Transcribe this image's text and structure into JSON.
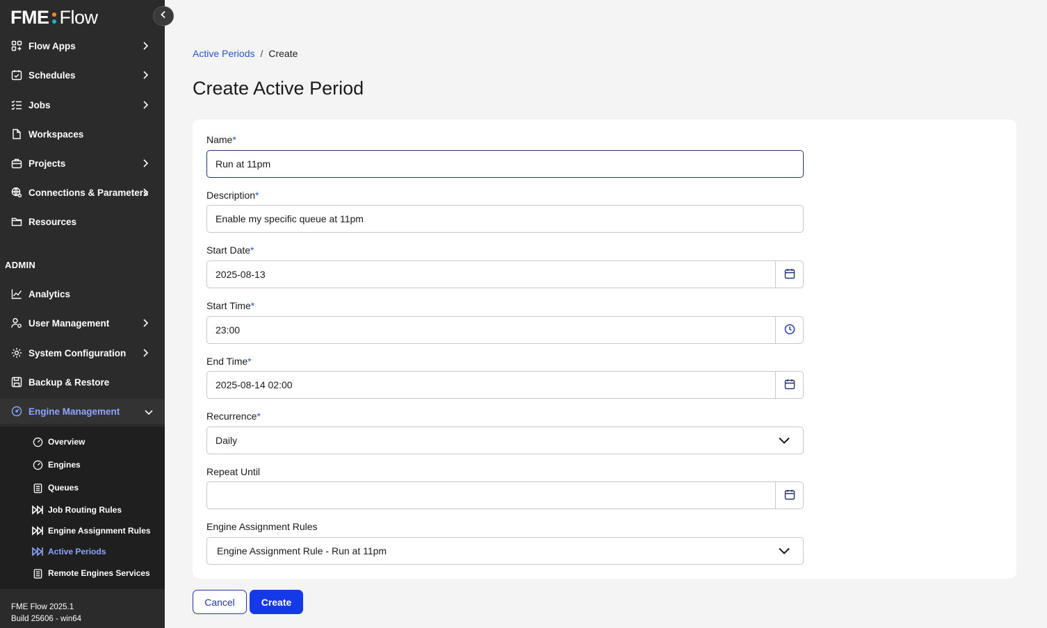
{
  "app": {
    "logo_left": "FME",
    "logo_right": "Flow"
  },
  "sidebar": {
    "items": [
      {
        "label": "Flow Apps",
        "icon": "grid-icon",
        "has_children": true
      },
      {
        "label": "Schedules",
        "icon": "calendar-check-icon",
        "has_children": true
      },
      {
        "label": "Jobs",
        "icon": "list-check-icon",
        "has_children": true
      },
      {
        "label": "Workspaces",
        "icon": "file-icon",
        "has_children": false
      },
      {
        "label": "Projects",
        "icon": "briefcase-icon",
        "has_children": true
      },
      {
        "label": "Connections & Parameters",
        "icon": "globe-gear-icon",
        "has_children": true
      },
      {
        "label": "Resources",
        "icon": "folder-icon",
        "has_children": false
      }
    ],
    "admin_label": "ADMIN",
    "admin_items": [
      {
        "label": "Analytics",
        "icon": "chart-line-icon",
        "has_children": false
      },
      {
        "label": "User Management",
        "icon": "user-gear-icon",
        "has_children": true
      },
      {
        "label": "System Configuration",
        "icon": "gear-icon",
        "has_children": true
      },
      {
        "label": "Backup & Restore",
        "icon": "save-icon",
        "has_children": false
      },
      {
        "label": "Engine Management",
        "icon": "gauge-icon",
        "has_children": true,
        "expanded": true,
        "active": true
      }
    ],
    "engine_subitems": [
      {
        "label": "Overview",
        "icon": "gauge-icon"
      },
      {
        "label": "Engines",
        "icon": "gauge-icon"
      },
      {
        "label": "Queues",
        "icon": "clipboard-icon"
      },
      {
        "label": "Job Routing Rules",
        "icon": "route-icon"
      },
      {
        "label": "Engine Assignment Rules",
        "icon": "route-icon"
      },
      {
        "label": "Active Periods",
        "icon": "route-icon",
        "active": true
      },
      {
        "label": "Remote Engines Services",
        "icon": "clipboard-icon"
      }
    ],
    "version_line1": "FME Flow 2025.1",
    "version_line2": "Build 25606 - win64"
  },
  "breadcrumb": {
    "parent": "Active Periods",
    "separator": "/",
    "current": "Create"
  },
  "page_title": "Create Active Period",
  "form": {
    "name": {
      "label": "Name",
      "required": "*",
      "value": "Run at 11pm"
    },
    "description": {
      "label": "Description",
      "required": "*",
      "value": "Enable my specific queue at 11pm"
    },
    "start_date": {
      "label": "Start Date",
      "required": "*",
      "value": "2025-08-13"
    },
    "start_time": {
      "label": "Start Time",
      "required": "*",
      "value": "23:00"
    },
    "end_time": {
      "label": "End Time",
      "required": "*",
      "value": "2025-08-14 02:00"
    },
    "recurrence": {
      "label": "Recurrence",
      "required": "*",
      "value": "Daily"
    },
    "repeat_until": {
      "label": "Repeat Until",
      "value": ""
    },
    "engine_assignment_rules": {
      "label": "Engine Assignment Rules",
      "value": "Engine Assignment Rule - Run at 11pm"
    }
  },
  "actions": {
    "cancel": "Cancel",
    "create": "Create"
  },
  "colors": {
    "sidebar_bg": "#2b2b2b",
    "accent": "#1339e8",
    "link": "#2a55c9",
    "active_nav": "#8ea5ff"
  }
}
